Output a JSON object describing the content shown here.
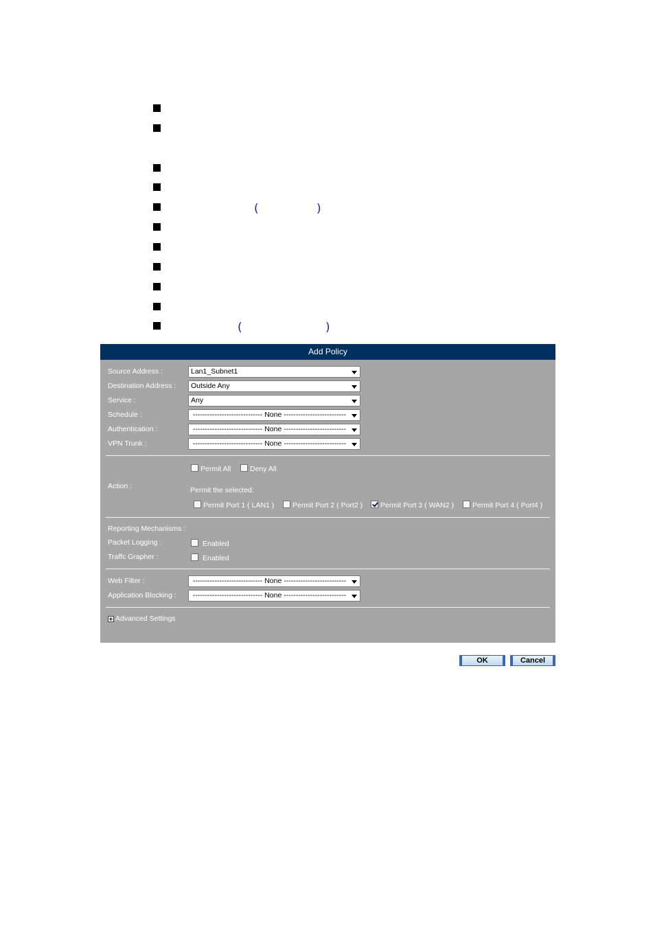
{
  "panel": {
    "title": "Add Policy",
    "fields": {
      "source_address": {
        "label": "Source Address :",
        "value": "Lan1_Subnet1"
      },
      "destination_address": {
        "label": "Destination Address :",
        "value": "Outside Any"
      },
      "service": {
        "label": "Service :",
        "value": "Any"
      },
      "schedule": {
        "label": "Schedule :",
        "value": "----------------------------- None --------------------------"
      },
      "authentication": {
        "label": "Authentication :",
        "value": "----------------------------- None --------------------------"
      },
      "vpn_trunk": {
        "label": "VPN Trunk :",
        "value": "----------------------------- None --------------------------"
      }
    },
    "action": {
      "label": "Action :",
      "permit_all": {
        "label": "Permit All",
        "checked": false
      },
      "deny_all": {
        "label": "Deny All",
        "checked": false
      },
      "permit_selected_label": "Permit the selected:",
      "ports": [
        {
          "label": "Permit Port 1 ( LAN1 )",
          "checked": false
        },
        {
          "label": "Permit Port 2 ( Port2 )",
          "checked": false
        },
        {
          "label": "Permit Port 3 ( WAN2 )",
          "checked": true
        },
        {
          "label": "Permit Port 4 ( Port4 )",
          "checked": false
        }
      ]
    },
    "reporting": {
      "label": "Reporting Mechanisms :",
      "packet_logging": {
        "label": "Packet Logging :",
        "option": "Enabled",
        "checked": false
      },
      "traffic_grapher": {
        "label": "Traffc Grapher :",
        "option": "Enabled",
        "checked": false
      }
    },
    "filters": {
      "web_filter": {
        "label": "Web Filter :",
        "value": "----------------------------- None --------------------------"
      },
      "application_blocking": {
        "label": "Application Blocking :",
        "value": "----------------------------- None --------------------------"
      }
    },
    "advanced_settings_label": "Advanced Settings"
  },
  "buttons": {
    "ok": "OK",
    "cancel": "Cancel"
  },
  "colors": {
    "title_bar": "#00305f",
    "panel_bg": "#a6a6a6",
    "paren": "#1f1fb0"
  },
  "text_fragments": {
    "paren_open": "(",
    "paren_close": ")"
  }
}
